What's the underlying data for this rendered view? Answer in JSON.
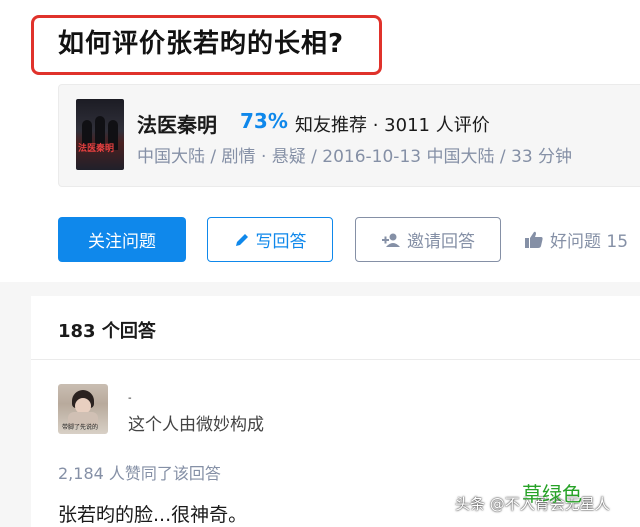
{
  "question": {
    "title": "如何评价张若昀的长相?"
  },
  "movie": {
    "poster_text": "法医秦明",
    "name": "法医秦明",
    "score": "73%",
    "recommend": "知友推荐 · 3011 人评价",
    "meta": "中国大陆 / 剧情 · 悬疑 / 2016-10-13 中国大陆 / 33 分钟"
  },
  "actions": {
    "follow_label": "关注问题",
    "write_label": "写回答",
    "invite_label": "邀请回答",
    "good_label": "好问题 15"
  },
  "answers": {
    "count_label": "183 个回答",
    "first": {
      "avatar_caption": "带脚了先说的",
      "author_name": "-",
      "author_bio": "这个人由微妙构成",
      "votes": "2,184 人赞同了该回答",
      "text": "张若昀的脸...很神奇。"
    }
  },
  "watermark": {
    "source": "头条 @不入骨会无星人",
    "overlay": "草绿色"
  },
  "colors": {
    "primary": "#0f88eb",
    "highlight_box": "#e0322b",
    "muted": "#8590a6",
    "watermark_green": "#27a227"
  }
}
